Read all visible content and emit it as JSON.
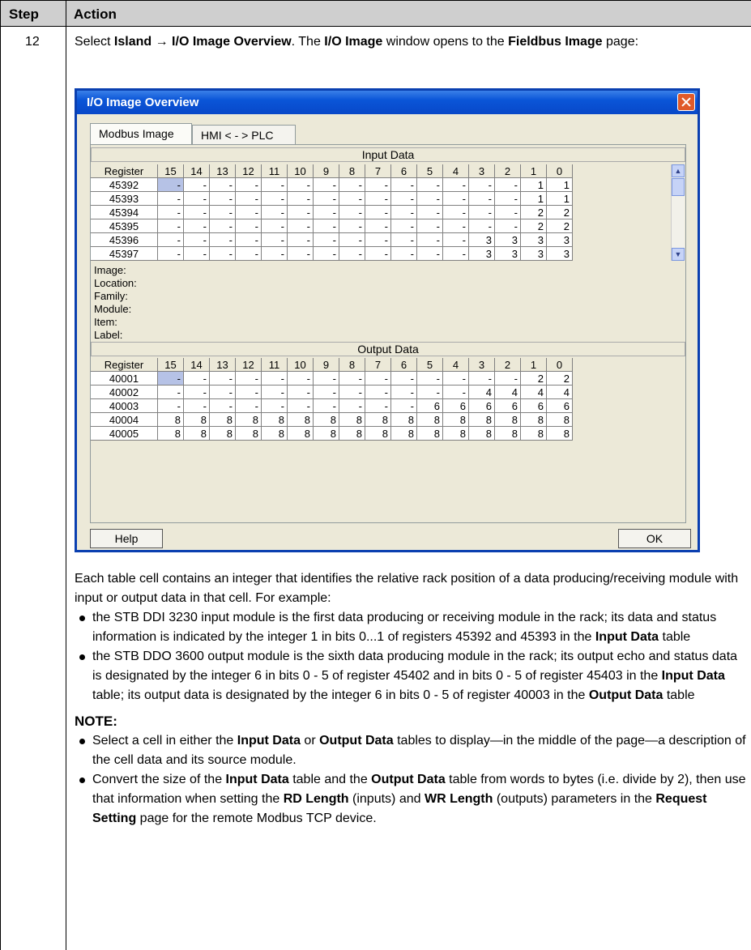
{
  "header": {
    "step": "Step",
    "action": "Action"
  },
  "step_number": "12",
  "intro": {
    "p1": "Select ",
    "island": "Island",
    "arrow": " → ",
    "menu_item": "I/O Image Overview",
    "p2": ". The ",
    "io_image": "I/O Image",
    "p3": " window opens to the ",
    "fieldbus": "Fieldbus Image",
    "p4": " page:"
  },
  "window": {
    "title": "I/O Image Overview",
    "tabs": [
      "Modbus Image",
      "HMI < - > PLC"
    ],
    "input_title": "Input Data",
    "output_title": "Output Data",
    "columns": [
      "Register",
      "15",
      "14",
      "13",
      "12",
      "11",
      "10",
      "9",
      "8",
      "7",
      "6",
      "5",
      "4",
      "3",
      "2",
      "1",
      "0"
    ],
    "input_rows": [
      [
        "45392",
        "-",
        "-",
        "-",
        "-",
        "-",
        "-",
        "-",
        "-",
        "-",
        "-",
        "-",
        "-",
        "-",
        "-",
        "1",
        "1"
      ],
      [
        "45393",
        "-",
        "-",
        "-",
        "-",
        "-",
        "-",
        "-",
        "-",
        "-",
        "-",
        "-",
        "-",
        "-",
        "-",
        "1",
        "1"
      ],
      [
        "45394",
        "-",
        "-",
        "-",
        "-",
        "-",
        "-",
        "-",
        "-",
        "-",
        "-",
        "-",
        "-",
        "-",
        "-",
        "2",
        "2"
      ],
      [
        "45395",
        "-",
        "-",
        "-",
        "-",
        "-",
        "-",
        "-",
        "-",
        "-",
        "-",
        "-",
        "-",
        "-",
        "-",
        "2",
        "2"
      ],
      [
        "45396",
        "-",
        "-",
        "-",
        "-",
        "-",
        "-",
        "-",
        "-",
        "-",
        "-",
        "-",
        "-",
        "3",
        "3",
        "3",
        "3"
      ],
      [
        "45397",
        "-",
        "-",
        "-",
        "-",
        "-",
        "-",
        "-",
        "-",
        "-",
        "-",
        "-",
        "-",
        "3",
        "3",
        "3",
        "3"
      ]
    ],
    "info_labels": [
      "Image:",
      "Location:",
      "Family:",
      "Module:",
      "Item:",
      "Label:"
    ],
    "output_rows": [
      [
        "40001",
        "-",
        "-",
        "-",
        "-",
        "-",
        "-",
        "-",
        "-",
        "-",
        "-",
        "-",
        "-",
        "-",
        "-",
        "2",
        "2"
      ],
      [
        "40002",
        "-",
        "-",
        "-",
        "-",
        "-",
        "-",
        "-",
        "-",
        "-",
        "-",
        "-",
        "-",
        "4",
        "4",
        "4",
        "4"
      ],
      [
        "40003",
        "-",
        "-",
        "-",
        "-",
        "-",
        "-",
        "-",
        "-",
        "-",
        "-",
        "6",
        "6",
        "6",
        "6",
        "6",
        "6"
      ],
      [
        "40004",
        "8",
        "8",
        "8",
        "8",
        "8",
        "8",
        "8",
        "8",
        "8",
        "8",
        "8",
        "8",
        "8",
        "8",
        "8",
        "8"
      ],
      [
        "40005",
        "8",
        "8",
        "8",
        "8",
        "8",
        "8",
        "8",
        "8",
        "8",
        "8",
        "8",
        "8",
        "8",
        "8",
        "8",
        "8"
      ]
    ],
    "help_label": "Help",
    "ok_label": "OK"
  },
  "body": {
    "para": "Each table cell contains an integer that identifies the relative rack position of a data producing/receiving module with input or output data in that cell. For example:",
    "b1_a": "the STB DDI 3230 input module is the first data producing or receiving module in the rack; its data and status information is indicated by the integer 1 in bits 0...1 of registers 45392 and 45393 in the ",
    "b1_bold": "Input Data",
    "b1_b": " table",
    "b2_a": "the STB DDO 3600 output module is the sixth data producing module in the rack; its output echo and status data is designated by the integer 6 in bits 0 - 5 of register 45402 and in bits 0 - 5 of register 45403 in the ",
    "b2_bold1": "Input Data",
    "b2_b": " table; its output data is designated by the integer 6 in bits 0 - 5 of register 40003 in the ",
    "b2_bold2": "Output Data",
    "b2_c": " table",
    "note_heading": "NOTE:",
    "n1_a": "Select a cell in either the ",
    "n1_bold1": "Input Data",
    "n1_b": " or ",
    "n1_bold2": "Output Data",
    "n1_c": " tables to display—in the middle of the page—a description of the cell data and its source module.",
    "n2_a": "Convert the size of the ",
    "n2_bold1": "Input Data",
    "n2_b": " table and the ",
    "n2_bold2": "Output Data",
    "n2_c": " table from words to bytes (i.e. divide by 2), then use that information when setting the ",
    "n2_bold3": "RD Length",
    "n2_d": " (inputs) and ",
    "n2_bold4": "WR Length",
    "n2_e": " (outputs) parameters in the ",
    "n2_bold5": "Request Setting",
    "n2_f": " page for the remote Modbus TCP device."
  }
}
